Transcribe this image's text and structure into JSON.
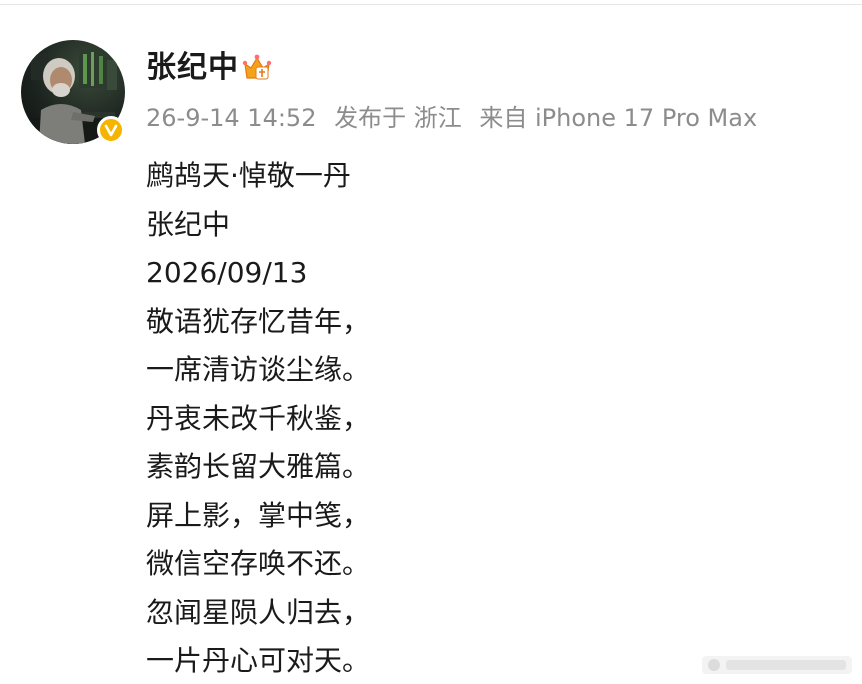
{
  "post": {
    "author": {
      "name": "张纪中",
      "avatar_icon": "avatar-photo",
      "verified_icon": "verified-v-icon",
      "badge_icon": "crown-badge-icon"
    },
    "meta": {
      "datetime": "26-9-14 14:52",
      "location": "发布于 浙江",
      "device": "来自 iPhone 17 Pro Max"
    },
    "lines": [
      "鹧鸪天·悼敬一丹",
      "张纪中",
      "2026/09/13",
      "敬语犹存忆昔年，",
      "一席清访谈尘缘。",
      "丹衷未改千秋鉴，",
      "素韵长留大雅篇。",
      "屏上影，掌中笺，",
      "微信空存唤不还。",
      "忽闻星陨人归去，",
      "一片丹心可对天。"
    ]
  },
  "colors": {
    "name": "#1a1a1a",
    "meta": "#8c8c8c",
    "text": "#1a1a1a",
    "verified": "#f5b400",
    "crown": "#f0a800"
  }
}
